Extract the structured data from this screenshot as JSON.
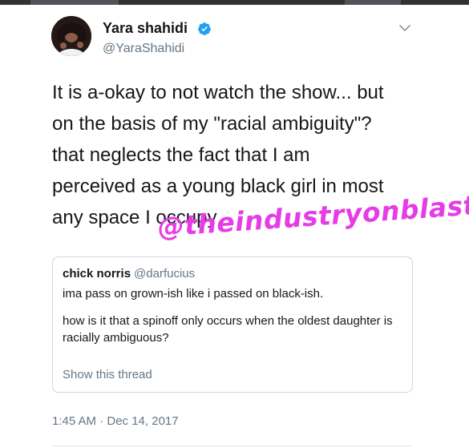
{
  "tweet": {
    "author_name": "Yara shahidi",
    "author_handle": "@YaraShahidi",
    "verified": true,
    "text_lines": [
      "It is a-okay to not watch the show... but",
      "on the basis of my \"racial ambiguity\"?",
      "that neglects the fact that I am",
      "perceived as a young black girl in most",
      "any space I occupy"
    ],
    "timestamp": "1:45 AM · Dec 14, 2017"
  },
  "watermark": "@theindustryonblast",
  "quoted_tweet": {
    "author_name": "chick norris",
    "author_handle": "@darfucius",
    "paragraphs": [
      "ima pass on grown-ish like i passed on black-ish.",
      "how is it that a spinoff only occurs when the oldest daughter is racially ambiguous?"
    ],
    "show_thread": "Show this thread"
  },
  "icons": {
    "verified": "verified-badge-icon",
    "menu": "chevron-down-icon"
  },
  "colors": {
    "verified_blue": "#1da1f2",
    "secondary_text": "#657786",
    "watermark_pink": "#e53ce6",
    "border": "#ccd6dd"
  }
}
